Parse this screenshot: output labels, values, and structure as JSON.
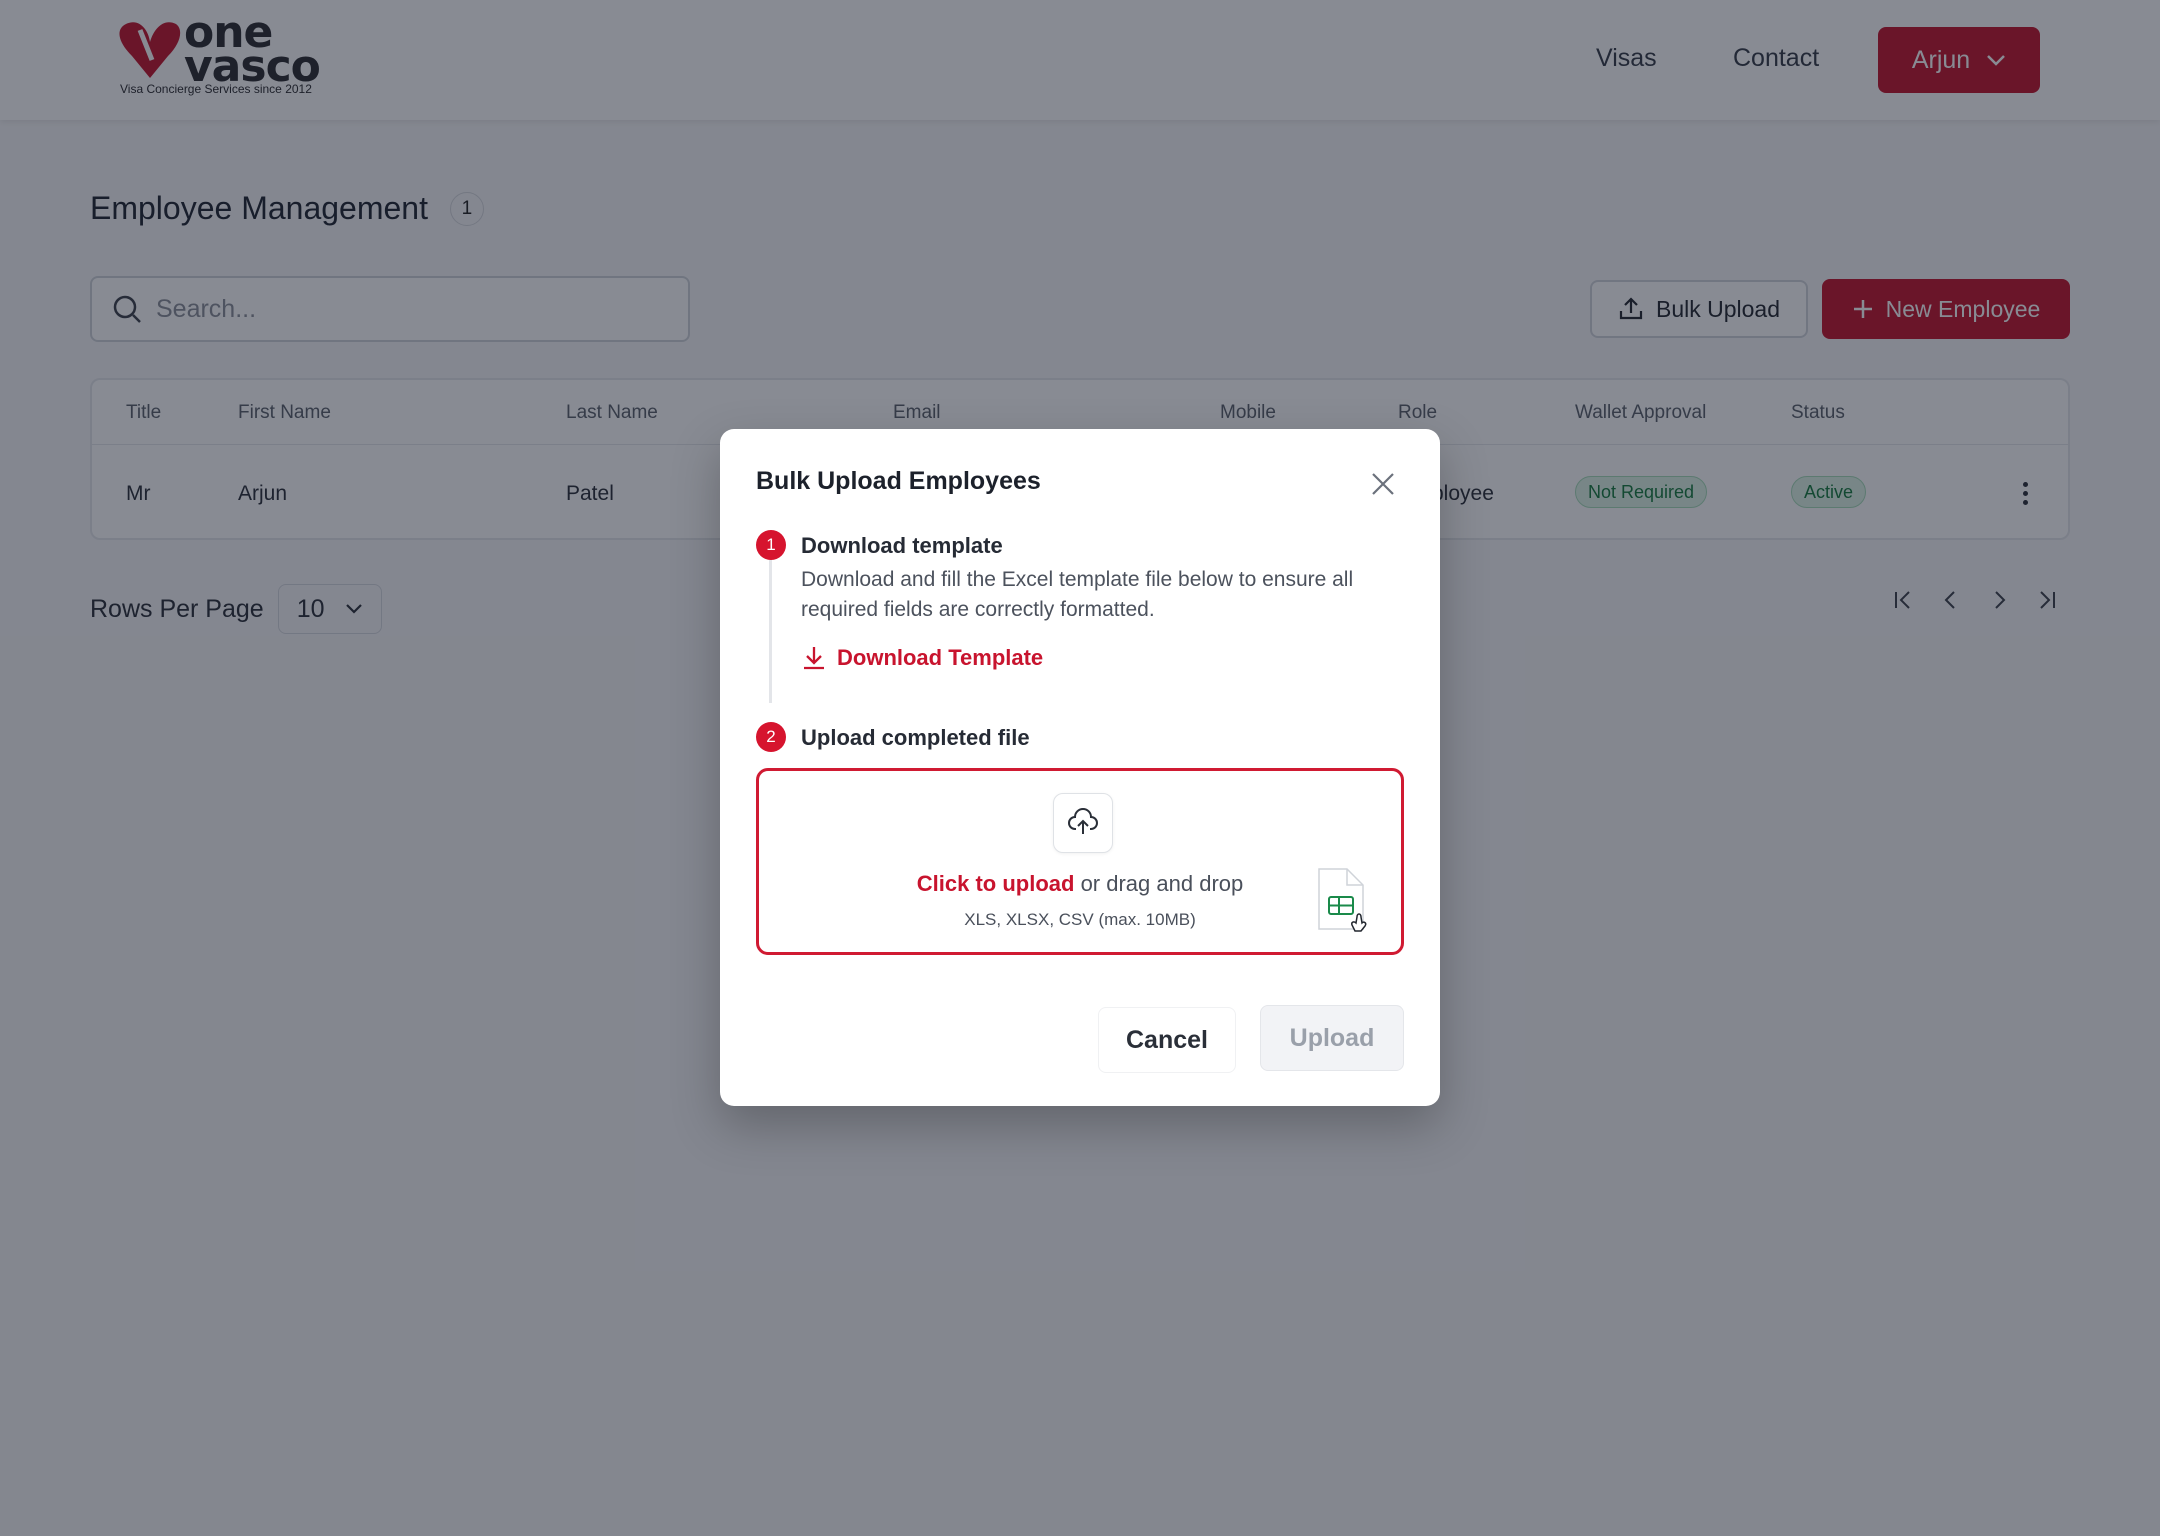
{
  "header": {
    "logo_word_top": "one",
    "logo_word_bottom": "vasco",
    "logo_tagline": "Visa Concierge Services since 2012",
    "nav": [
      "Visas",
      "Contact"
    ],
    "user_name": "Arjun",
    "brand_color": "#c3132b"
  },
  "page": {
    "title": "Employee Management",
    "count": "1",
    "search_placeholder": "Search...",
    "bulk_upload_label": "Bulk Upload",
    "new_employee_label": "New Employee"
  },
  "table": {
    "columns": [
      "Title",
      "First Name",
      "Last Name",
      "Email",
      "Mobile",
      "Role",
      "Wallet Approval",
      "Status"
    ],
    "rows": [
      {
        "title": "Mr",
        "first_name": "Arjun",
        "last_name": "Patel",
        "role_visible": "ployee",
        "wallet_approval": "Not Required",
        "status": "Active"
      }
    ]
  },
  "pagination": {
    "rows_per_page_label": "Rows Per Page",
    "rows_per_page_value": "10"
  },
  "modal": {
    "title": "Bulk Upload Employees",
    "step1": {
      "number": "1",
      "title": "Download template",
      "description": "Download and fill the Excel template file below to ensure all required fields are correctly formatted.",
      "link_label": "Download Template"
    },
    "step2": {
      "number": "2",
      "title": "Upload completed file"
    },
    "dropzone": {
      "click_label": "Click to upload",
      "rest_label": " or drag and drop",
      "hint": "XLS, XLSX, CSV (max. 10MB)"
    },
    "cancel_label": "Cancel",
    "upload_label": "Upload"
  }
}
